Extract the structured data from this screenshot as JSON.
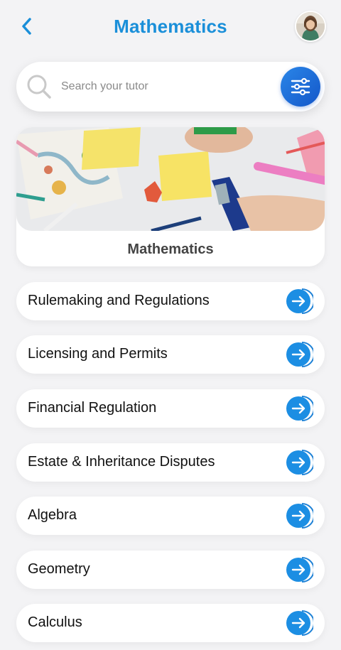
{
  "header": {
    "title": "Mathematics",
    "back_icon": "chevron-left-icon",
    "avatar_icon": "user-avatar"
  },
  "search": {
    "placeholder": "Search your tutor",
    "value": "",
    "filter_icon": "sliders-icon"
  },
  "hero": {
    "caption": "Mathematics",
    "image": "math-desk-photo"
  },
  "list": {
    "items": [
      {
        "label": "Rulemaking and Regulations"
      },
      {
        "label": "Licensing and Permits"
      },
      {
        "label": "Financial Regulation"
      },
      {
        "label": "Estate & Inheritance Disputes"
      },
      {
        "label": "Algebra"
      },
      {
        "label": "Geometry"
      },
      {
        "label": "Calculus"
      }
    ],
    "arrow_icon": "arrow-right-icon"
  },
  "colors": {
    "accent": "#1a8fd9",
    "filter_button": "#1a64d4",
    "background": "#f3f3f5"
  }
}
